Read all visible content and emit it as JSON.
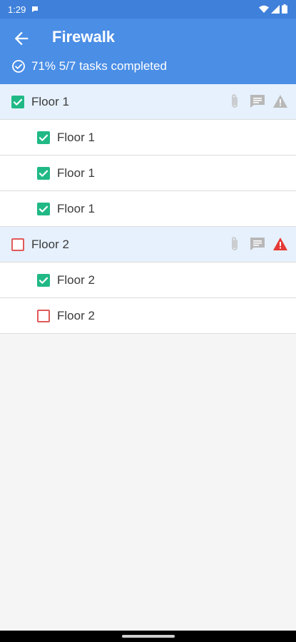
{
  "status_bar": {
    "time": "1:29"
  },
  "app_bar": {
    "title": "Firewalk",
    "progress_text": "71% 5/7 tasks completed",
    "progress_fraction": 0.71
  },
  "groups": [
    {
      "label": "Floor 1",
      "checked": true,
      "warning_color": "#b8b8b8",
      "tasks": [
        {
          "label": "Floor 1",
          "checked": true
        },
        {
          "label": "Floor 1",
          "checked": true
        },
        {
          "label": "Floor 1",
          "checked": true
        }
      ]
    },
    {
      "label": "Floor 2",
      "checked": false,
      "warning_color": "#e53935",
      "tasks": [
        {
          "label": "Floor 2",
          "checked": true
        },
        {
          "label": "Floor 2",
          "checked": false
        }
      ]
    }
  ],
  "icons": {
    "back": "arrow-left-icon",
    "progress": "check-circle-icon",
    "attach": "paperclip-icon",
    "comment": "comment-icon",
    "warning": "warning-icon"
  },
  "colors": {
    "status_bar": "#3f80da",
    "app_bar": "#4a8ee6",
    "group_row": "#e6f1fd",
    "checked": "#20b986",
    "unchecked": "#e05a58",
    "icon_grey": "#b8b8b8",
    "warning_red": "#e53935"
  }
}
